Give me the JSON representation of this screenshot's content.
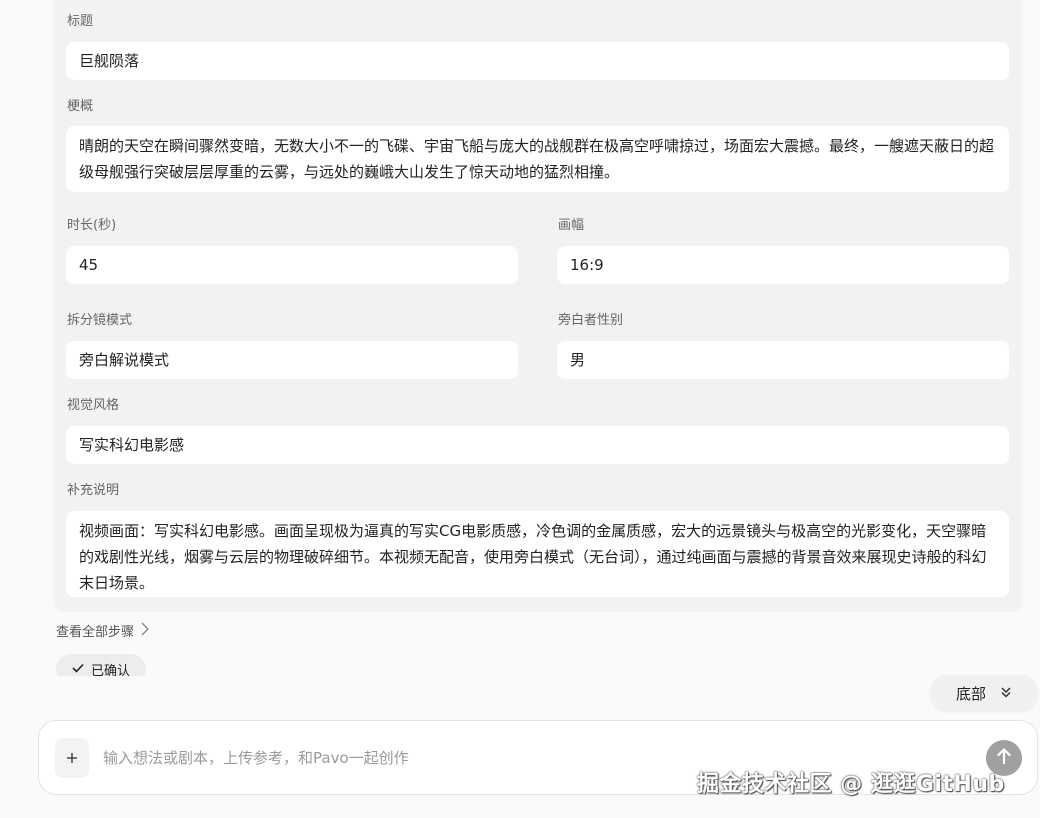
{
  "form": {
    "title_label": "标题",
    "title_value": "巨舰陨落",
    "synopsis_label": "梗概",
    "synopsis_value": "晴朗的天空在瞬间骤然变暗，无数大小不一的飞碟、宇宙飞船与庞大的战舰群在极高空呼啸掠过，场面宏大震撼。最终，一艘遮天蔽日的超级母舰强行突破层层厚重的云雾，与远处的巍峨大山发生了惊天动地的猛烈相撞。",
    "duration_label": "时长(秒)",
    "duration_value": "45",
    "aspect_label": "画幅",
    "aspect_value": "16:9",
    "split_mode_label": "拆分镜模式",
    "split_mode_value": "旁白解说模式",
    "narrator_gender_label": "旁白者性别",
    "narrator_gender_value": "男",
    "visual_style_label": "视觉风格",
    "visual_style_value": "写实科幻电影感",
    "notes_label": "补充说明",
    "notes_value": "视频画面：写实科幻电影感。画面呈现极为逼真的写实CG电影质感，冷色调的金属质感，宏大的远景镜头与极高空的光影变化，天空骤暗的戏剧性光线，烟雾与云层的物理破碎细节。本视频无配音，使用旁白模式（无台词），通过纯画面与震撼的背景音效来展现史诗般的科幻末日场景。"
  },
  "actions": {
    "view_all_steps": "查看全部步骤",
    "confirmed_label": "已确认",
    "bottom_label": "底部"
  },
  "composer": {
    "placeholder": "输入想法或剧本，上传参考，和Pavo一起创作",
    "plus_icon": "plus-icon",
    "send_icon": "arrow-up-icon"
  },
  "watermark": "掘金技术社区 @ 逛逛GitHub"
}
